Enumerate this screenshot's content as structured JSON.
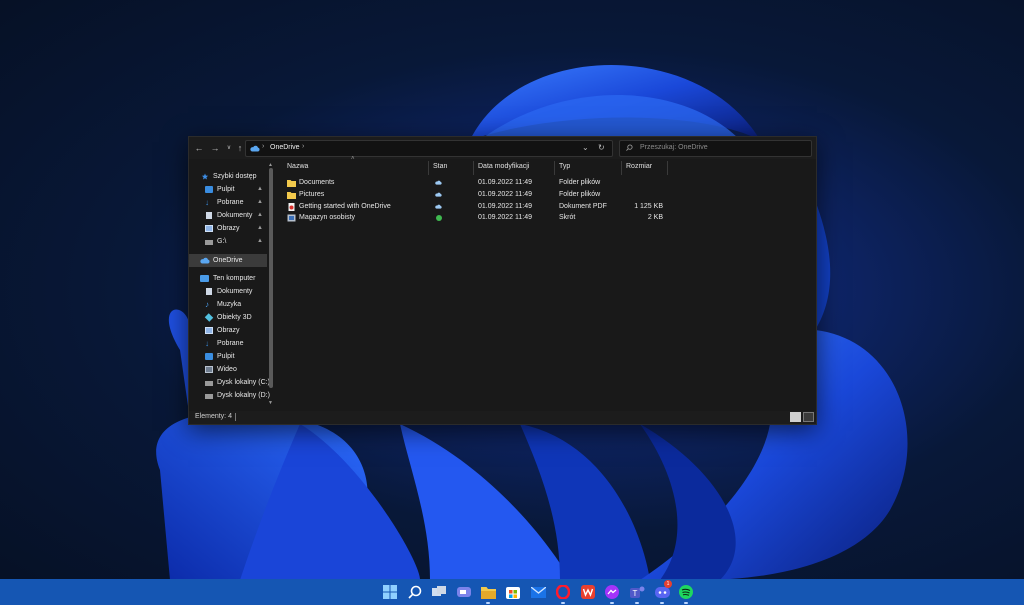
{
  "window": {
    "breadcrumb_location": "OneDrive",
    "search_placeholder": "Przeszukaj: OneDrive"
  },
  "sidebar": {
    "items": [
      {
        "label": "Szybki dostęp",
        "icon": "star-icon",
        "pinned": false
      },
      {
        "label": "Pulpit",
        "icon": "desktop-folder-icon",
        "pinned": true
      },
      {
        "label": "Pobrane",
        "icon": "download-icon",
        "pinned": true
      },
      {
        "label": "Dokumenty",
        "icon": "document-icon",
        "pinned": true
      },
      {
        "label": "Obrazy",
        "icon": "pictures-icon",
        "pinned": true
      },
      {
        "label": "G:\\",
        "icon": "drive-icon",
        "pinned": true
      },
      {
        "label": "OneDrive",
        "icon": "cloud-icon",
        "selected": true
      },
      {
        "label": "Ten komputer",
        "icon": "computer-icon"
      },
      {
        "label": "Dokumenty",
        "icon": "document-icon"
      },
      {
        "label": "Muzyka",
        "icon": "music-icon"
      },
      {
        "label": "Obiekty 3D",
        "icon": "cube-icon"
      },
      {
        "label": "Obrazy",
        "icon": "pictures-icon"
      },
      {
        "label": "Pobrane",
        "icon": "download-icon"
      },
      {
        "label": "Pulpit",
        "icon": "desktop-folder-icon"
      },
      {
        "label": "Wideo",
        "icon": "video-icon"
      },
      {
        "label": "Dysk lokalny (C:)",
        "icon": "drive-icon"
      },
      {
        "label": "Dysk lokalny (D:)",
        "icon": "drive-icon"
      }
    ]
  },
  "columns": {
    "name": "Nazwa",
    "status": "Stan",
    "modified": "Data modyfikacji",
    "type": "Typ",
    "size": "Rozmiar"
  },
  "files": [
    {
      "name": "Documents",
      "status_icon": "cloud-icon",
      "modified": "01.09.2022 11:49",
      "type": "Folder plików",
      "size": "",
      "icon": "folder-icon"
    },
    {
      "name": "Pictures",
      "status_icon": "cloud-icon",
      "modified": "01.09.2022 11:49",
      "type": "Folder plików",
      "size": "",
      "icon": "folder-icon"
    },
    {
      "name": "Getting started with OneDrive",
      "status_icon": "cloud-icon",
      "modified": "01.09.2022 11:49",
      "type": "Dokument PDF",
      "size": "1 125 KB",
      "icon": "pdf-icon"
    },
    {
      "name": "Magazyn osobisty",
      "status_icon": "check-circle-icon",
      "modified": "01.09.2022 11:49",
      "type": "Skrót",
      "size": "2 KB",
      "icon": "vault-shortcut-icon"
    }
  ],
  "status_bar": {
    "text": "Elementy: 4"
  },
  "taskbar": {
    "icons": [
      "start-icon",
      "search-icon",
      "task-view-icon",
      "chat-icon",
      "file-explorer-icon",
      "store-icon",
      "mail-icon",
      "opera-icon",
      "wps-office-icon",
      "messenger-icon",
      "teams-icon",
      "discord-icon",
      "spotify-icon"
    ],
    "discord_badge": "1"
  },
  "colors": {
    "accent": "#1556b3",
    "window_bg": "#191919",
    "selection": "#3b3b3b",
    "folder": "#f2c94c",
    "cloud": "#5aa6f0"
  }
}
